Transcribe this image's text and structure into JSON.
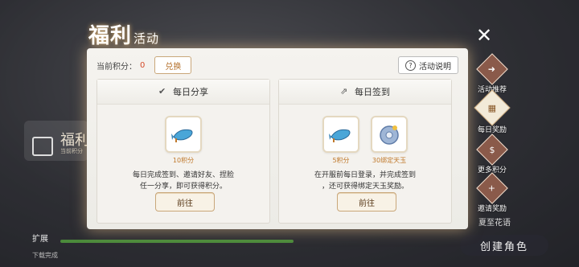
{
  "header": {
    "title_main": "福利",
    "title_sub": "活动"
  },
  "toolbar": {
    "points_label": "当前积分：",
    "points_value": "0",
    "exchange_label": "兑换",
    "help_label": "活动说明"
  },
  "cards": [
    {
      "title": "每日分享",
      "rewards": [
        {
          "label": "10积分",
          "icon": "fish-icon"
        }
      ],
      "desc_line1": "每日完成签到、邀请好友、捏脸",
      "desc_line2": "任一分享，即可获得积分。",
      "button": "前往"
    },
    {
      "title": "每日签到",
      "rewards": [
        {
          "label": "5积分",
          "icon": "fish-icon"
        },
        {
          "label": "30绑定天玉",
          "icon": "jade-icon"
        }
      ],
      "desc_line1": "在开服前每日登录，并完成签到",
      "desc_line2": "，还可获得绑定天玉奖励。",
      "button": "前往"
    }
  ],
  "sidebar": {
    "items": [
      {
        "label": "活动推荐"
      },
      {
        "label": "每日奖励"
      },
      {
        "label": "更多积分"
      },
      {
        "label": "邀请奖励"
      }
    ]
  },
  "background": {
    "panel_title": "福利",
    "panel_sub": "当前积分",
    "bottom_label": "扩展",
    "bottom_sub": "下载完成",
    "create_label": "创建角色",
    "right_small": "夏至花语"
  }
}
